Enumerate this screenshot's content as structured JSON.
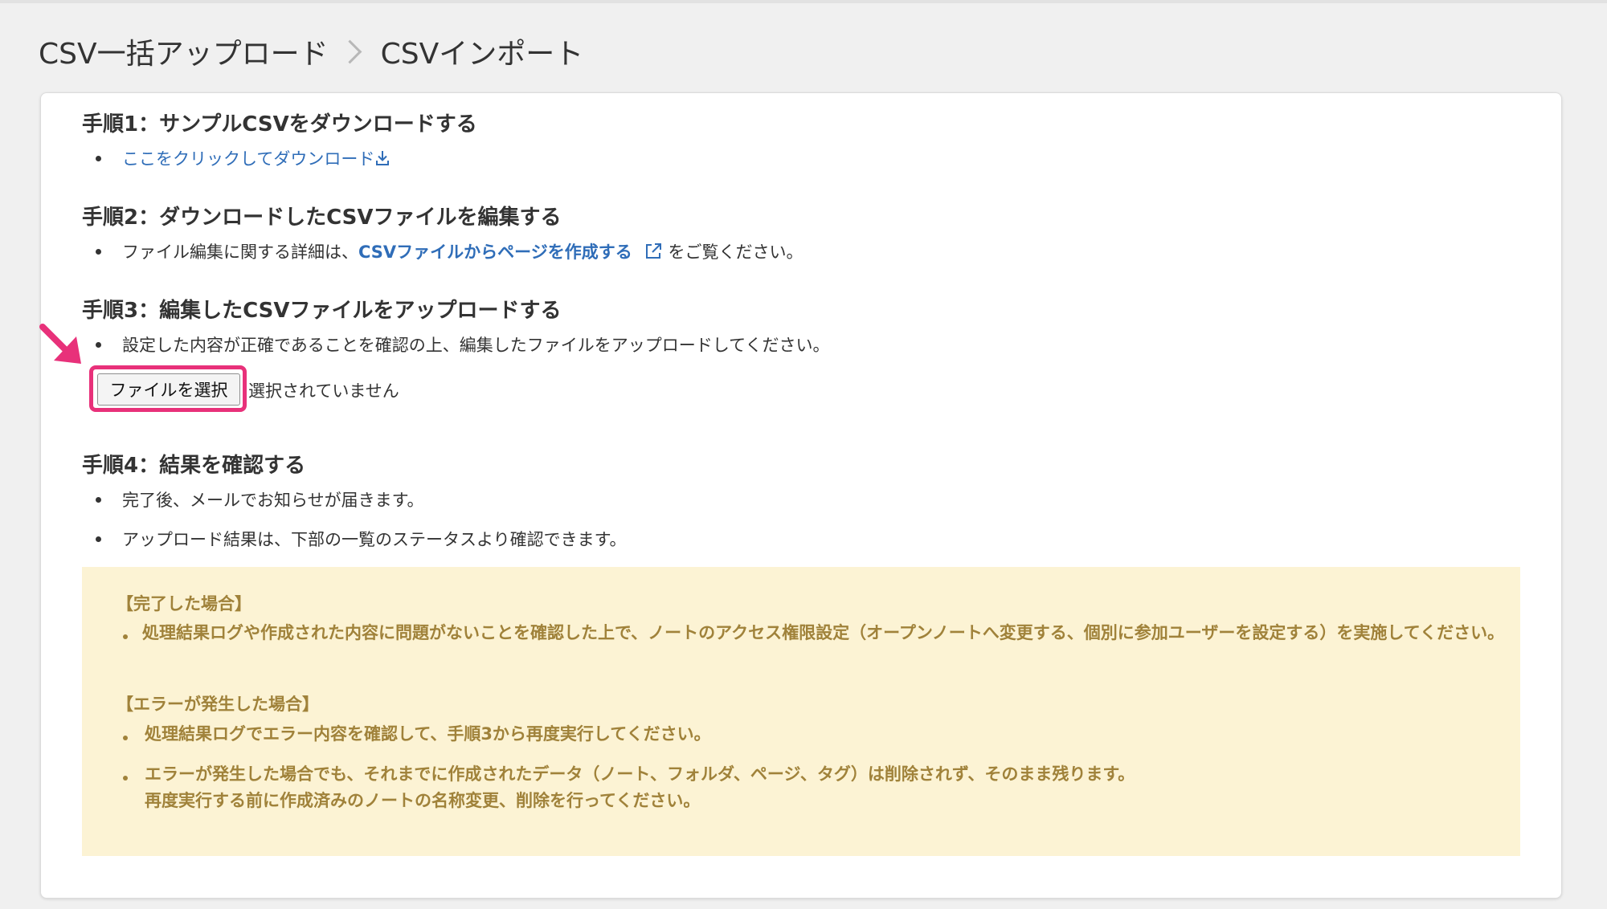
{
  "breadcrumb": {
    "parent": "CSV一括アップロード",
    "current": "CSVインポート"
  },
  "step1": {
    "title": "手順1：サンプルCSVをダウンロードする",
    "link": "ここをクリックしてダウンロード"
  },
  "step2": {
    "title": "手順2：ダウンロードしたCSVファイルを編集する",
    "prefix": "ファイル編集に関する詳細は、",
    "link": "CSVファイルからページを作成する",
    "suffix": "をご覧ください。"
  },
  "step3": {
    "title": "手順3：編集したCSVファイルをアップロードする",
    "text": "設定した内容が正確であることを確認の上、編集したファイルをアップロードしてください。",
    "file_button": "ファイルを選択",
    "file_status": "選択されていません"
  },
  "step4": {
    "title": "手順4：結果を確認する",
    "items": [
      "完了後、メールでお知らせが届きます。",
      "アップロード結果は、下部の一覧のステータスより確認できます。"
    ]
  },
  "notice": {
    "complete_heading": "【完了した場合】",
    "complete_item": "処理結果ログや作成された内容に問題がないことを確認した上で、ノートのアクセス権限設定（オープンノートへ変更する、個別に参加ユーザーを設定する）を実施してください。",
    "error_heading": "【エラーが発生した場合】",
    "error_item1": "処理結果ログでエラー内容を確認して、手順3から再度実行してください。",
    "error_item2_line1": "エラーが発生した場合でも、それまでに作成されたデータ（ノート、フォルダ、ページ、タグ）は削除されず、そのまま残ります。",
    "error_item2_line2": "再度実行する前に作成済みのノートの名称変更、削除を行ってください。"
  },
  "colors": {
    "link": "#2f6db8",
    "highlight": "#e8317a",
    "notice_bg": "#fcf3d4",
    "notice_text": "#a0823a"
  },
  "icons": [
    "download-icon",
    "external-link-icon",
    "pointer-arrow-icon"
  ]
}
